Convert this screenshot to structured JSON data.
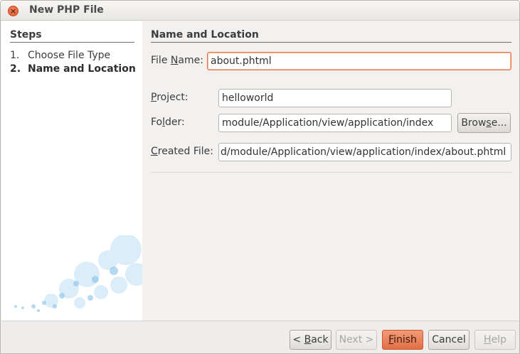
{
  "window": {
    "title": "New PHP File",
    "close_icon": "×"
  },
  "steps": {
    "title": "Steps",
    "items": [
      {
        "num": "1.",
        "label": "Choose File Type"
      },
      {
        "num": "2.",
        "label": "Name and Location"
      }
    ]
  },
  "main": {
    "section_title": "Name and Location",
    "file_name": {
      "label_pre": "File ",
      "label_u": "N",
      "label_post": "ame:",
      "value": "about.phtml"
    },
    "project": {
      "label_u": "P",
      "label_post": "roject:",
      "value": "helloworld"
    },
    "folder": {
      "label_pre": "Fo",
      "label_u": "l",
      "label_post": "der:",
      "value": "module/Application/view/application/index"
    },
    "browse": {
      "pre": "Brow",
      "u": "s",
      "post": "e..."
    },
    "created_file": {
      "label_u": "C",
      "label_post": "reated File:",
      "value": "d/module/Application/view/application/index/about.phtml"
    }
  },
  "footer": {
    "back": {
      "pre": "< ",
      "u": "B",
      "post": "ack"
    },
    "next": "Next >",
    "finish": {
      "u": "F",
      "post": "inish"
    },
    "cancel": "Cancel",
    "help": {
      "u": "H",
      "post": "elp"
    }
  },
  "colors": {
    "accent": "#e36f45",
    "focus_border": "#e5784d",
    "bubble": "#a8d4f0"
  }
}
